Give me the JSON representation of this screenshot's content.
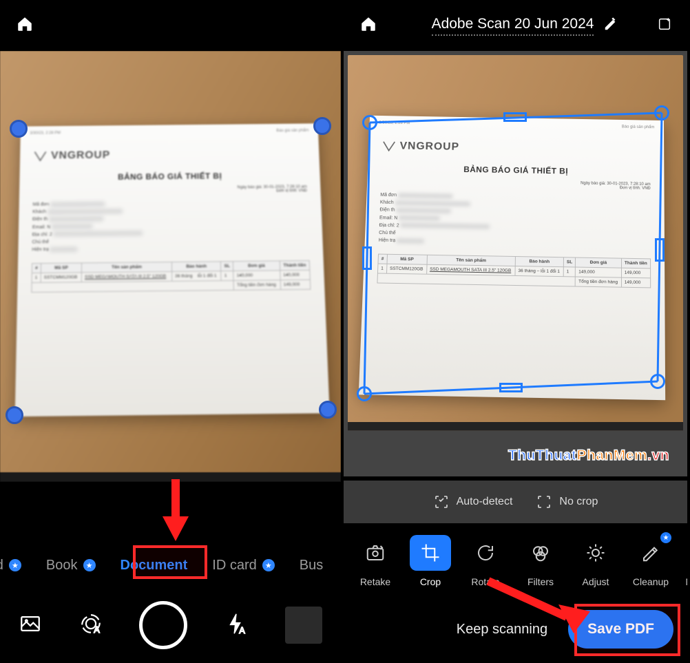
{
  "left": {
    "modes": {
      "partial_left": "ard",
      "book": "Book",
      "document": "Document",
      "idcard": "ID card",
      "partial_right": "Bus"
    }
  },
  "right": {
    "title": "Adobe Scan 20 Jun 2024",
    "crop_tools": {
      "auto": "Auto-detect",
      "nocrop": "No crop"
    },
    "tools": {
      "retake": "Retake",
      "crop": "Crop",
      "rotate": "Rotate",
      "filters": "Filters",
      "adjust": "Adjust",
      "cleanup": "Cleanup",
      "markup": "Marku"
    },
    "keep": "Keep scanning",
    "save": "Save PDF"
  },
  "paper": {
    "timestamp": "3/30/23, 2:28 PM",
    "top_right": "Báo giá sản phẩm",
    "brand": "VNGROUP",
    "heading": "BẢNG BÁO GIÁ THIẾT BỊ",
    "date_line": "Ngày báo giá: 30-01-2023, 7:28:10 am",
    "unit_line": "Đơn vị tính: VNĐ",
    "cust_labels": [
      "Mã đơn",
      "Khách",
      "Điện th",
      "Email: N",
      "Địa chỉ: 2",
      "Chủ thể",
      "Hiện trạ"
    ],
    "table": {
      "cols": [
        "#",
        "Mã SP",
        "Tên sản phẩm",
        "Bảo hành",
        "SL",
        "Đơn giá",
        "Thành tiền"
      ],
      "row": [
        "1",
        "SSTCMM120GB",
        "SSD MEGAMOUTH SATA III 2.5\" 120GB",
        "36 tháng – lỗi 1 đổi 1",
        "1",
        "149,000",
        "149,000"
      ],
      "total_label": "Tổng tiền đơn hàng",
      "total": "149,000"
    }
  },
  "watermark": {
    "a": "ThuThuat",
    "b": "PhanMem",
    "c": ".vn"
  },
  "colors": {
    "accent": "#1f7bff",
    "handle": "#3a72e8",
    "highlight": "#ff2a2a"
  }
}
